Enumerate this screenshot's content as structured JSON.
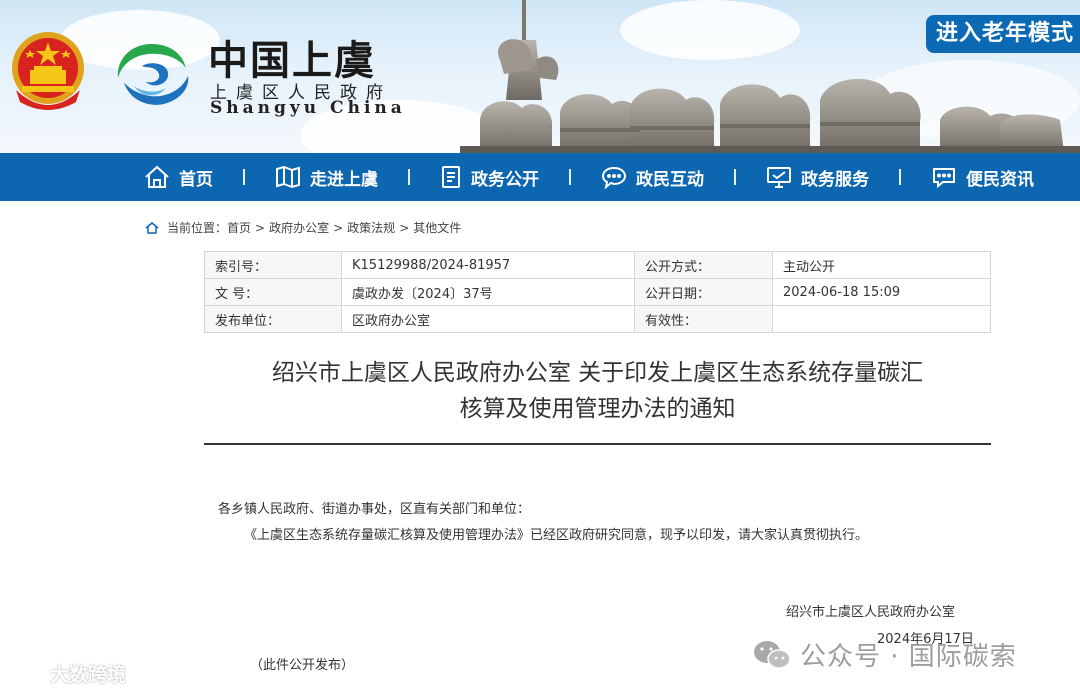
{
  "header": {
    "site_name": "中国上虞",
    "site_sub": "上虞区人民政府",
    "site_en": "Shangyu China",
    "elder_mode": "进入老年模式"
  },
  "nav": {
    "items": [
      {
        "label": "首页",
        "icon": "home-icon"
      },
      {
        "label": "走进上虞",
        "icon": "map-icon"
      },
      {
        "label": "政务公开",
        "icon": "document-icon"
      },
      {
        "label": "政民互动",
        "icon": "chat-icon"
      },
      {
        "label": "政务服务",
        "icon": "monitor-icon"
      },
      {
        "label": "便民资讯",
        "icon": "message-icon"
      }
    ]
  },
  "breadcrumb": {
    "prefix": "当前位置：",
    "items": [
      "首页",
      "政府办公室",
      "政策法规",
      "其他文件"
    ],
    "separator": ">"
  },
  "meta": {
    "index_label": "索引号：",
    "index_value": "K15129988/2024-81957",
    "disclosure_label": "公开方式：",
    "disclosure_value": "主动公开",
    "doc_no_label": "文 号：",
    "doc_no_value": "虞政办发〔2024〕37号",
    "date_label": "公开日期：",
    "date_value": "2024-06-18 15:09",
    "issuer_label": "发布单位：",
    "issuer_value": "区政府办公室",
    "validity_label": "有效性：",
    "validity_value": ""
  },
  "document": {
    "title_line1": "绍兴市上虞区人民政府办公室 关于印发上虞区生态系统存量碳汇",
    "title_line2": "核算及使用管理办法的通知",
    "salutation": "各乡镇人民政府、街道办事处，区直有关部门和单位：",
    "body": "《上虞区生态系统存量碳汇核算及使用管理办法》已经区政府研究同意，现予以印发，请大家认真贯彻执行。",
    "signer": "绍兴市上虞区人民政府办公室",
    "sign_date": "2024年6月17日",
    "note": "（此件公开发布）"
  },
  "watermarks": {
    "left": "大数跨境",
    "right": "公众号 · 国际碳索"
  },
  "colors": {
    "nav_blue": "#0d66b0",
    "elder_blue": "#0c6ab5"
  }
}
